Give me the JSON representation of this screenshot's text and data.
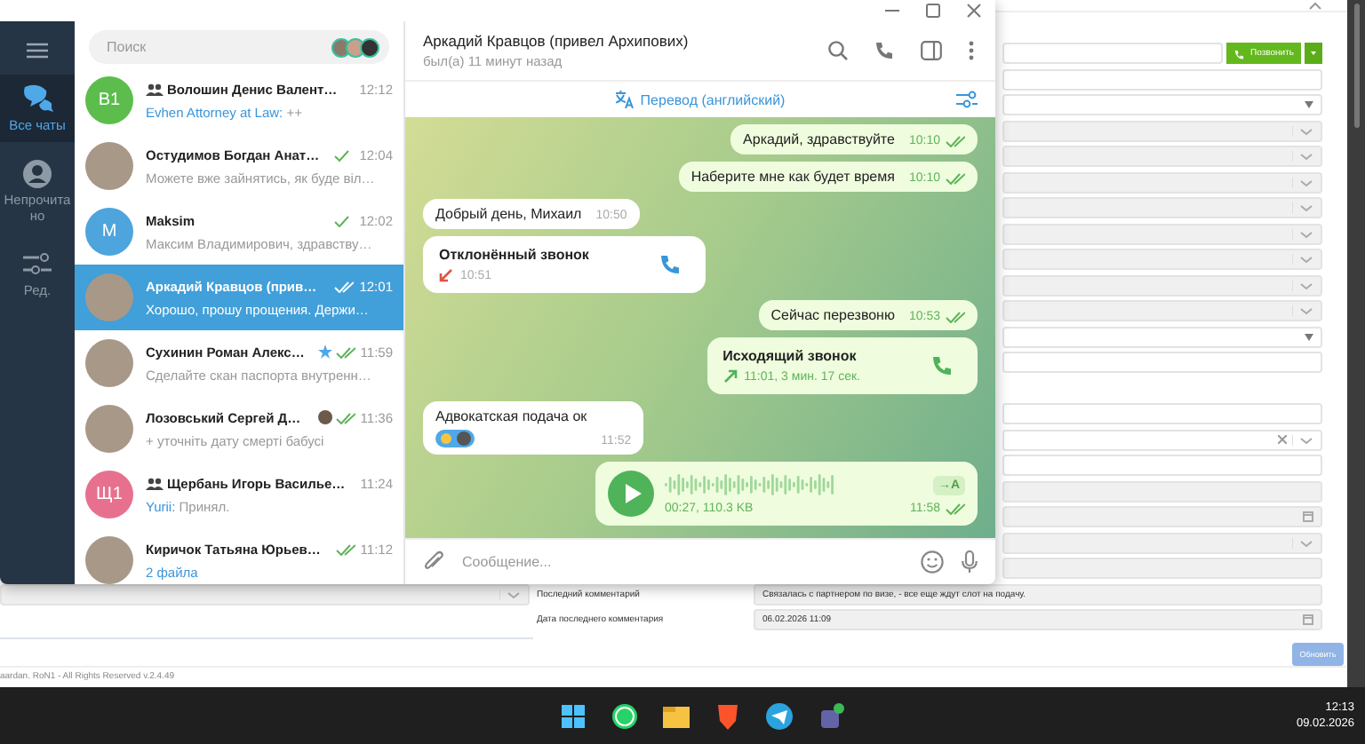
{
  "telegram": {
    "rail": [
      {
        "kind": "chats",
        "label": "Все чаты",
        "selected": true
      },
      {
        "kind": "unread",
        "label": "Непрочитано",
        "selected": false
      },
      {
        "kind": "edit",
        "label": "Ред.",
        "selected": false
      }
    ],
    "search": {
      "placeholder": "Поиск"
    },
    "chats": [
      {
        "name": "Волошин Денис Валент…",
        "group": true,
        "avatar": {
          "kind": "initials",
          "text": "В1",
          "color": "#5cbd4c"
        },
        "sender": "Evhen Attorney at Law:",
        "preview": "++",
        "accent": false,
        "time": "12:12",
        "sent": false,
        "read": false,
        "starred": false,
        "badge_avatar": false,
        "selected": false
      },
      {
        "name": "Остудимов Богдан Анат…",
        "group": false,
        "avatar": {
          "kind": "photo"
        },
        "preview": "Можете вже зайнятись, як буде віл…",
        "accent": false,
        "time": "12:04",
        "sent": true,
        "read": false,
        "starred": false,
        "badge_avatar": false,
        "selected": false
      },
      {
        "name": "Maksim",
        "group": false,
        "avatar": {
          "kind": "initials",
          "text": "M",
          "color": "#4ea4dd"
        },
        "preview": "Максим Владимирович, здравству…",
        "accent": false,
        "time": "12:02",
        "sent": true,
        "read": false,
        "starred": false,
        "badge_avatar": false,
        "selected": false
      },
      {
        "name": "Аркадий Кравцов (прив…",
        "group": false,
        "avatar": {
          "kind": "photo"
        },
        "preview": "Хорошо, прошу прощения. Держи…",
        "accent": false,
        "time": "12:01",
        "sent": true,
        "read": true,
        "starred": false,
        "badge_avatar": false,
        "selected": true
      },
      {
        "name": "Сухинин Роман Алекс…",
        "group": false,
        "avatar": {
          "kind": "photo"
        },
        "preview": "Сделайте скан паспорта внутренн…",
        "accent": false,
        "time": "11:59",
        "sent": true,
        "read": true,
        "starred": true,
        "badge_avatar": false,
        "selected": false
      },
      {
        "name": "Лозовський Сергей Д…",
        "group": false,
        "avatar": {
          "kind": "photo"
        },
        "preview": "+ уточніть дату смерті бабусі",
        "accent": false,
        "time": "11:36",
        "sent": true,
        "read": true,
        "starred": false,
        "badge_avatar": true,
        "selected": false
      },
      {
        "name": "Щербань Игорь Василье…",
        "group": true,
        "avatar": {
          "kind": "initials",
          "text": "Щ1",
          "color": "#e8708f"
        },
        "sender": "Yurii:",
        "preview": "Принял.",
        "accent": false,
        "time": "11:24",
        "sent": false,
        "read": false,
        "starred": false,
        "badge_avatar": false,
        "selected": false
      },
      {
        "name": "Киричок Татьяна Юрьев…",
        "group": false,
        "avatar": {
          "kind": "photo"
        },
        "preview": "2 файла",
        "accent": true,
        "time": "11:12",
        "sent": true,
        "read": true,
        "starred": false,
        "badge_avatar": false,
        "selected": false
      }
    ],
    "header": {
      "title": "Аркадий Кравцов (привел Архипових)",
      "status": "был(а) 11 минут назад"
    },
    "translate_bar": {
      "label": "Перевод (английский)"
    },
    "messages": [
      {
        "kind": "text",
        "outgoing": true,
        "text": "Аркадий, здравствуйте",
        "time": "10:10",
        "read": true
      },
      {
        "kind": "text",
        "outgoing": true,
        "text": "Наберите мне как будет время",
        "time": "10:10",
        "read": true
      },
      {
        "kind": "text",
        "outgoing": false,
        "text": "Добрый день, Михаил",
        "time": "10:50"
      },
      {
        "kind": "call",
        "outgoing": false,
        "title": "Отклонённый звонок",
        "detail": "10:51"
      },
      {
        "kind": "text",
        "outgoing": true,
        "text": "Сейчас перезвоню",
        "time": "10:53",
        "read": true
      },
      {
        "kind": "call",
        "outgoing": true,
        "title": "Исходящий звонок",
        "detail": "11:01, 3 мин. 17 сек."
      },
      {
        "kind": "text",
        "outgoing": false,
        "text": "Адвокатская подача ок",
        "time": "11:52",
        "reactions": true
      },
      {
        "kind": "voice",
        "outgoing": true,
        "transcribe": "→A",
        "info": "00:27, 110.3 KB",
        "time": "11:58",
        "read": true
      }
    ],
    "composer": {
      "placeholder": "Сообщение..."
    }
  },
  "crm": {
    "call_button": "Позвонить",
    "fields_top": [
      {
        "kind": "call"
      },
      {
        "kind": "text"
      },
      {
        "kind": "select"
      },
      {
        "kind": "locked"
      },
      {
        "kind": "locked"
      },
      {
        "kind": "locked"
      },
      {
        "kind": "locked"
      },
      {
        "kind": "locked"
      },
      {
        "kind": "locked"
      },
      {
        "kind": "locked"
      },
      {
        "kind": "locked"
      },
      {
        "kind": "select"
      },
      {
        "kind": "text"
      }
    ],
    "fields_bottom": [
      {
        "kind": "text"
      },
      {
        "kind": "clearable"
      },
      {
        "kind": "text"
      },
      {
        "kind": "readonly"
      },
      {
        "kind": "date"
      },
      {
        "kind": "locked"
      },
      {
        "kind": "readonly"
      }
    ],
    "labeled_fields": [
      {
        "label": "Последний комментарий",
        "kind": "readonly",
        "value": "Связалась с партнером по визе, - все еще ждут  слот на подачу.",
        "side_select": true
      },
      {
        "label": "Дата последнего комментария",
        "kind": "date",
        "value": "06.02.2026 11:09"
      }
    ],
    "update_button": "Обновить",
    "footer": "aardan. RoN1 - All Rights Reserved v.2.4.49"
  },
  "taskbar": {
    "time": "12:13",
    "date": "09.02.2026"
  }
}
